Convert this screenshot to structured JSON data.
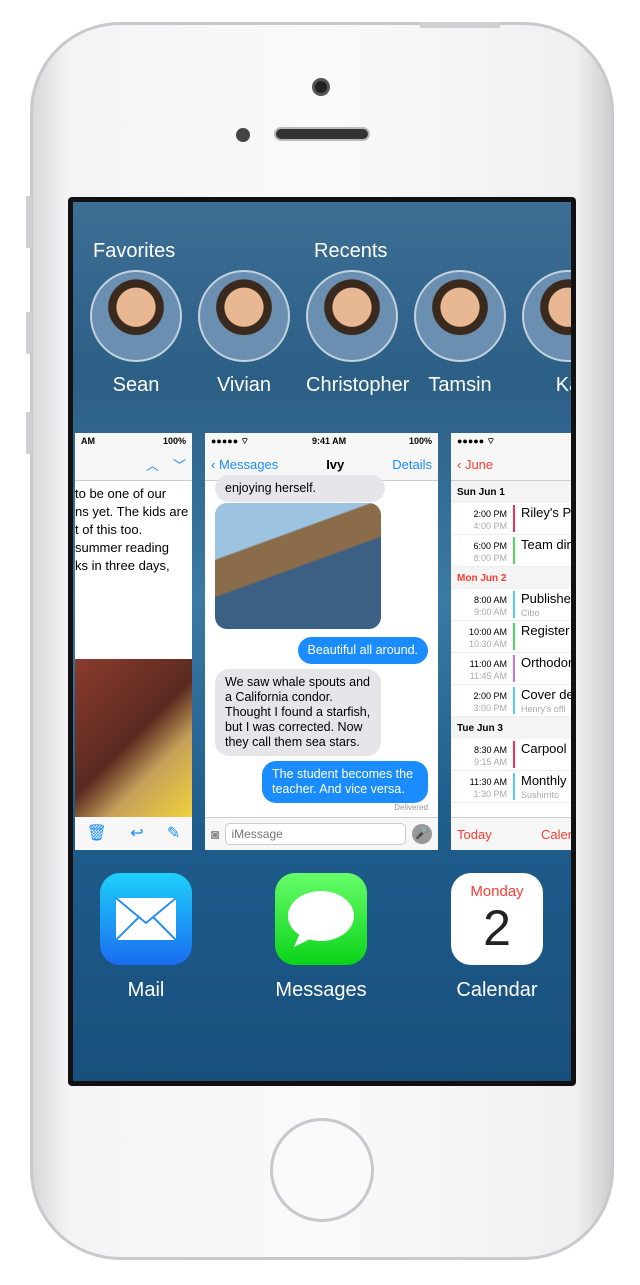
{
  "contacts": {
    "favorites_label": "Favorites",
    "recents_label": "Recents",
    "people": [
      {
        "name": "Sean"
      },
      {
        "name": "Vivian"
      },
      {
        "name": "Christopher"
      },
      {
        "name": "Tamsin"
      },
      {
        "name": "Ka"
      }
    ]
  },
  "mail_card": {
    "time": "AM",
    "battery": "100%",
    "body": [
      "to be one of our",
      "ns yet. The kids are",
      "t of this too.",
      "summer reading",
      "ks in three days,"
    ]
  },
  "messages_card": {
    "time": "9:41 AM",
    "battery": "100%",
    "back": "Messages",
    "title": "Ivy",
    "details": "Details",
    "messages": [
      {
        "dir": "in",
        "text": "enjoying herself."
      },
      {
        "dir": "out",
        "text": "Beautiful all around."
      },
      {
        "dir": "in",
        "text": "We saw whale spouts and a California condor. Thought I found a starfish, but I was corrected. Now they call them sea stars."
      },
      {
        "dir": "out",
        "text": "The student becomes the teacher. And vice versa."
      }
    ],
    "delivered": "Delivered",
    "input_placeholder": "iMessage"
  },
  "calendar_card": {
    "back": "June",
    "days": [
      {
        "label": "Sun  Jun 1",
        "today": false,
        "events": [
          {
            "start": "2:00 PM",
            "end": "4:00 PM",
            "title": "Riley's P",
            "sub": "",
            "color": "#ff2d55"
          },
          {
            "start": "6:00 PM",
            "end": "8:00 PM",
            "title": "Team din",
            "sub": "",
            "color": "#4cd964"
          }
        ]
      },
      {
        "label": "Mon  Jun 2",
        "today": true,
        "events": [
          {
            "start": "8:00 AM",
            "end": "9:00 AM",
            "title": "Publishe",
            "sub": "Cibo",
            "color": "#5ac8fa"
          },
          {
            "start": "10:00 AM",
            "end": "10:30 AM",
            "title": "Register",
            "sub": "",
            "color": "#4cd964"
          },
          {
            "start": "11:00 AM",
            "end": "11:45 AM",
            "title": "Orthodon",
            "sub": "",
            "color": "#cc73e1"
          },
          {
            "start": "2:00 PM",
            "end": "3:00 PM",
            "title": "Cover de",
            "sub": "Henry's offi",
            "color": "#5ac8fa"
          }
        ]
      },
      {
        "label": "Tue  Jun 3",
        "today": false,
        "events": [
          {
            "start": "8:30 AM",
            "end": "9:15 AM",
            "title": "Carpool",
            "sub": "",
            "color": "#ff2d55"
          },
          {
            "start": "11:30 AM",
            "end": "1:30 PM",
            "title": "Monthly",
            "sub": "Sushirrito",
            "color": "#5ac8fa"
          }
        ]
      }
    ],
    "today": "Today",
    "calendars": "Calen"
  },
  "apps": [
    {
      "name": "Mail",
      "icon": "envelope-icon"
    },
    {
      "name": "Messages",
      "icon": "speech-bubble-icon"
    },
    {
      "name": "Calendar",
      "icon": "calendar-icon",
      "weekday": "Monday",
      "date": "2"
    }
  ]
}
